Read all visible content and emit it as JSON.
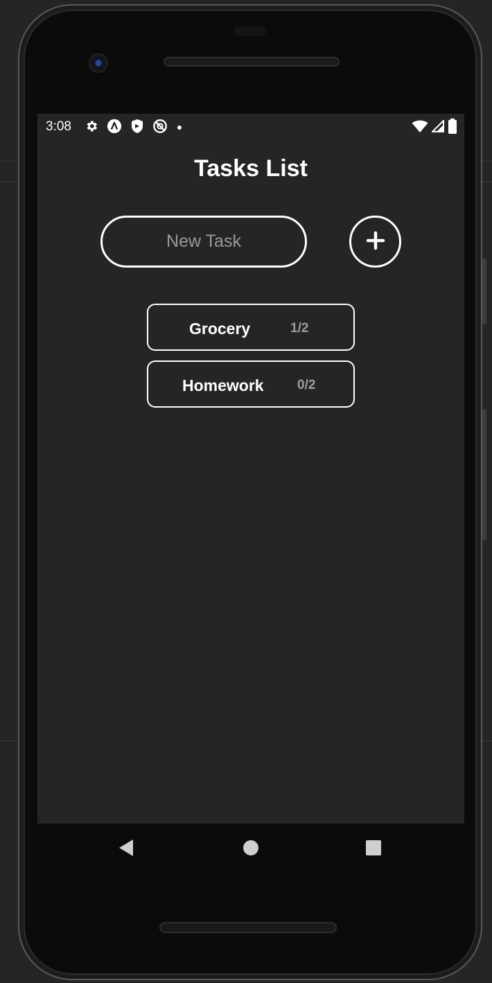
{
  "status_bar": {
    "time": "3:08",
    "left_icons": [
      "gear-icon",
      "ampere-icon",
      "shield-icon",
      "no-disturb-icon",
      "dot-icon"
    ],
    "right_icons": [
      "wifi-icon",
      "signal-icon",
      "battery-icon"
    ]
  },
  "header": {
    "title": "Tasks List"
  },
  "new_task": {
    "placeholder": "New Task",
    "value": ""
  },
  "add_button": {
    "icon": "plus-icon"
  },
  "tasks": [
    {
      "name": "Grocery",
      "count": "1/2"
    },
    {
      "name": "Homework",
      "count": "0/2"
    }
  ],
  "nav": {
    "icons": [
      "back-icon",
      "home-icon",
      "recents-icon"
    ]
  },
  "colors": {
    "background": "#252525",
    "foreground": "#ffffff",
    "muted": "#9e9e9e",
    "device_frame": "#0b0b0b"
  }
}
